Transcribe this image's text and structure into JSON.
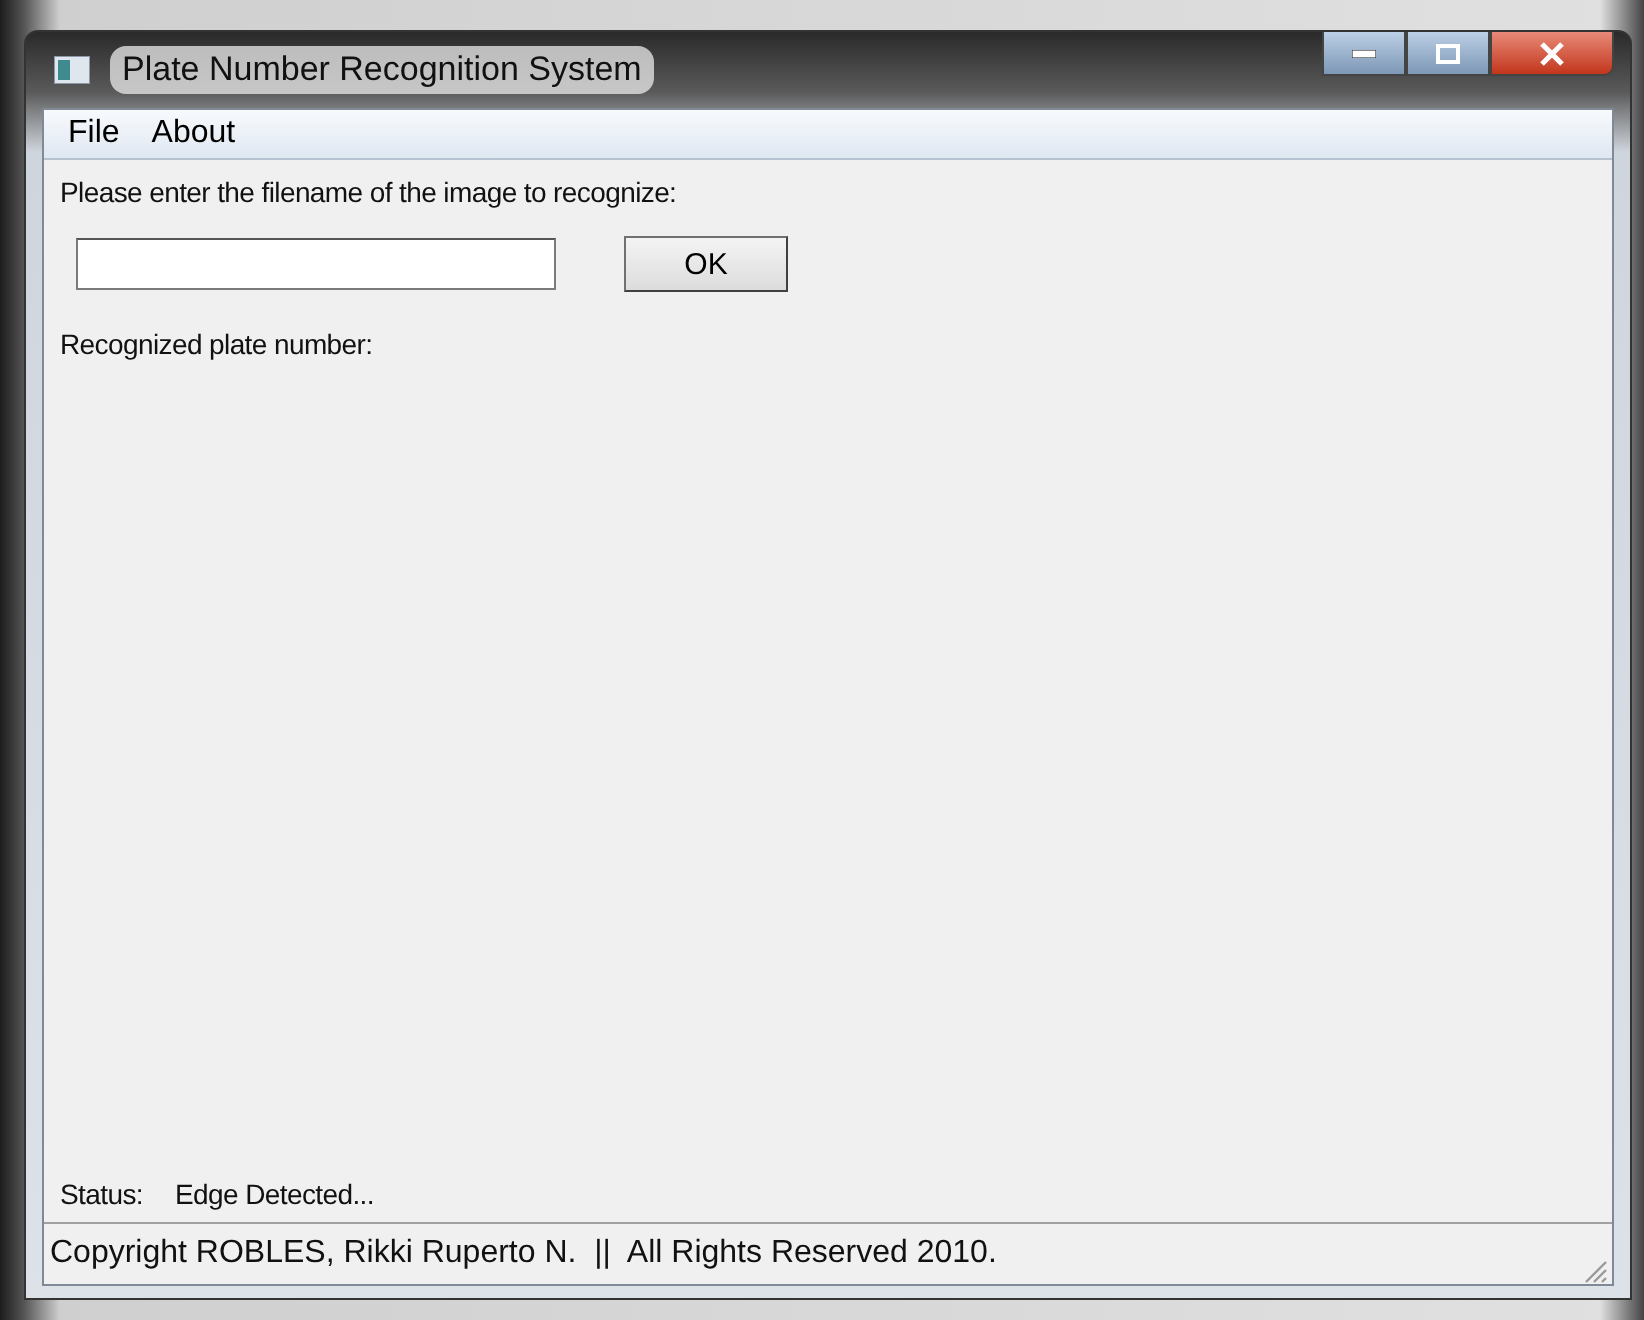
{
  "window": {
    "title": "Plate Number Recognition System"
  },
  "menu": [
    "File",
    "About"
  ],
  "prompt": "Please enter the filename of the image to recognize:",
  "ok_button": "OK",
  "result_label": "Recognized plate number:",
  "status": {
    "label": "Status:",
    "value": "Edge Detected..."
  },
  "status_bar": "Copyright ROBLES, Rikki Ruperto N.  ||  All Rights Reserved 2010."
}
